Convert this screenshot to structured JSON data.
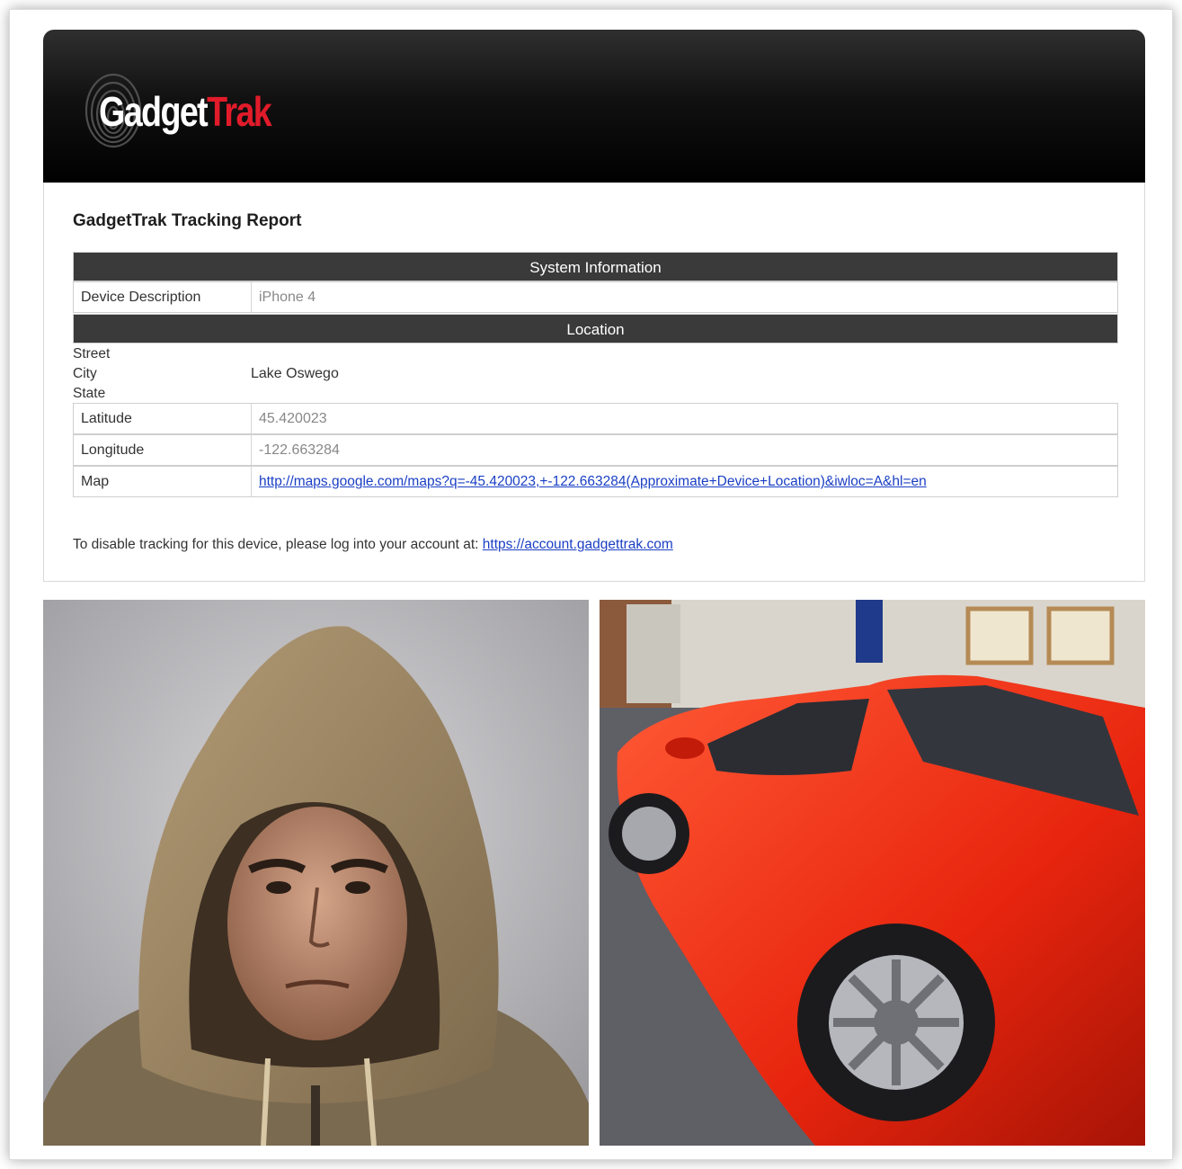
{
  "brand": {
    "logo_text_1": "Gadget",
    "logo_text_2": "Trak",
    "accent_color": "#e21b2a"
  },
  "report": {
    "title": "GadgetTrak Tracking Report",
    "system_info_header": "System Information",
    "device_description_label": "Device Description",
    "device_description_value": "iPhone 4",
    "location_header": "Location",
    "street_label": "Street",
    "city_label": "City",
    "state_label": "State",
    "city_value": "Lake Oswego",
    "latitude_label": "Latitude",
    "latitude_value": "45.420023",
    "longitude_label": "Longitude",
    "longitude_value": "-122.663284",
    "map_label": "Map",
    "map_url": "http://maps.google.com/maps?q=-45.420023,+-122.663284(Approximate+Device+Location)&iwloc=A&hl=en",
    "disable_text": "To disable tracking for this device, please log into your account at: ",
    "account_url": "https://account.gadgettrak.com"
  },
  "photos": {
    "left_icon": "hooded-person-photo",
    "right_icon": "red-sports-car-photo"
  }
}
